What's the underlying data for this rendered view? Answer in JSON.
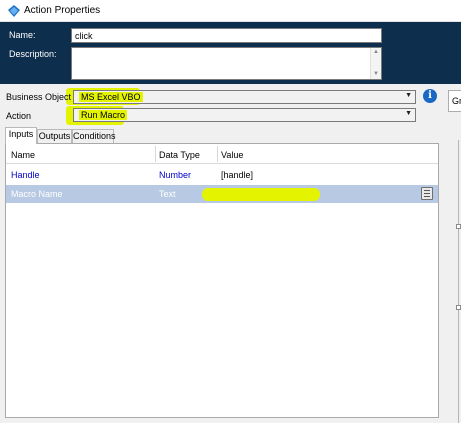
{
  "window": {
    "title": "Action Properties",
    "icon": "action-properties-icon"
  },
  "header": {
    "name_label": "Name:",
    "name_value": "click",
    "description_label": "Description:",
    "description_value": ""
  },
  "form": {
    "business_object_label": "Business Object",
    "business_object_value": "MS Excel VBO",
    "action_label": "Action",
    "action_value": "Run Macro",
    "info_icon": "i"
  },
  "tabs": [
    {
      "label": "Inputs",
      "active": true
    },
    {
      "label": "Outputs",
      "active": false
    },
    {
      "label": "Conditions",
      "active": false
    }
  ],
  "grid": {
    "columns": [
      "Name",
      "Data Type",
      "Value"
    ],
    "rows": [
      {
        "name": "Handle",
        "type": "Number",
        "value": "[handle]",
        "selected": false
      },
      {
        "name": "Macro Name",
        "type": "Text",
        "value": "",
        "selected": true
      }
    ]
  },
  "right_panel": {
    "label": "Gr"
  },
  "colors": {
    "header_bg": "#0e2e4e",
    "highlight": "#e4f400",
    "selected_row": "#b7c9e3",
    "link_blue": "#0000cc",
    "info_blue": "#1b67c4"
  }
}
